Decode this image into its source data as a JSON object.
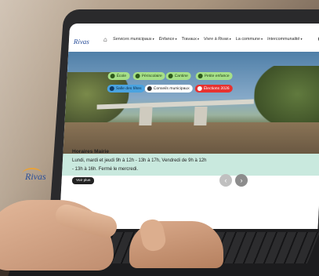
{
  "nav": {
    "logo": "Rivas",
    "menu": [
      "Services municipaux",
      "Enfance",
      "Travaux",
      "Vivre à Rivas",
      "La commune",
      "Intercommunalité"
    ]
  },
  "quick_links": [
    {
      "label": "École",
      "style": "green",
      "icon": "school-icon"
    },
    {
      "label": "Périscolaire",
      "style": "green",
      "icon": "child-icon"
    },
    {
      "label": "Cantine",
      "style": "green",
      "icon": "utensils-icon"
    },
    {
      "label": "Petite enfance",
      "style": "green",
      "icon": "heart-icon"
    },
    {
      "label": "Salle des fêtes",
      "style": "blue",
      "icon": "building-icon"
    },
    {
      "label": "Conseils municipaux",
      "style": "white",
      "icon": "document-icon"
    },
    {
      "label": "Élections 2026",
      "style": "red",
      "icon": "ballot-icon"
    }
  ],
  "hours": {
    "logo": "Rivas",
    "title": "Horaires Mairie",
    "line1": "Lundi, mardi et jeudi 9h à 12h - 13h à 17h, Vendredi de 9h à 12h",
    "line2": "- 13h à 16h. Fermé le mercredi.",
    "button": "Voir plus",
    "prev": "‹",
    "next": "›"
  },
  "colors": {
    "green": "#a6e088",
    "blue": "#4aa3e0",
    "red": "#e8312f",
    "band": "#c9e9de"
  }
}
